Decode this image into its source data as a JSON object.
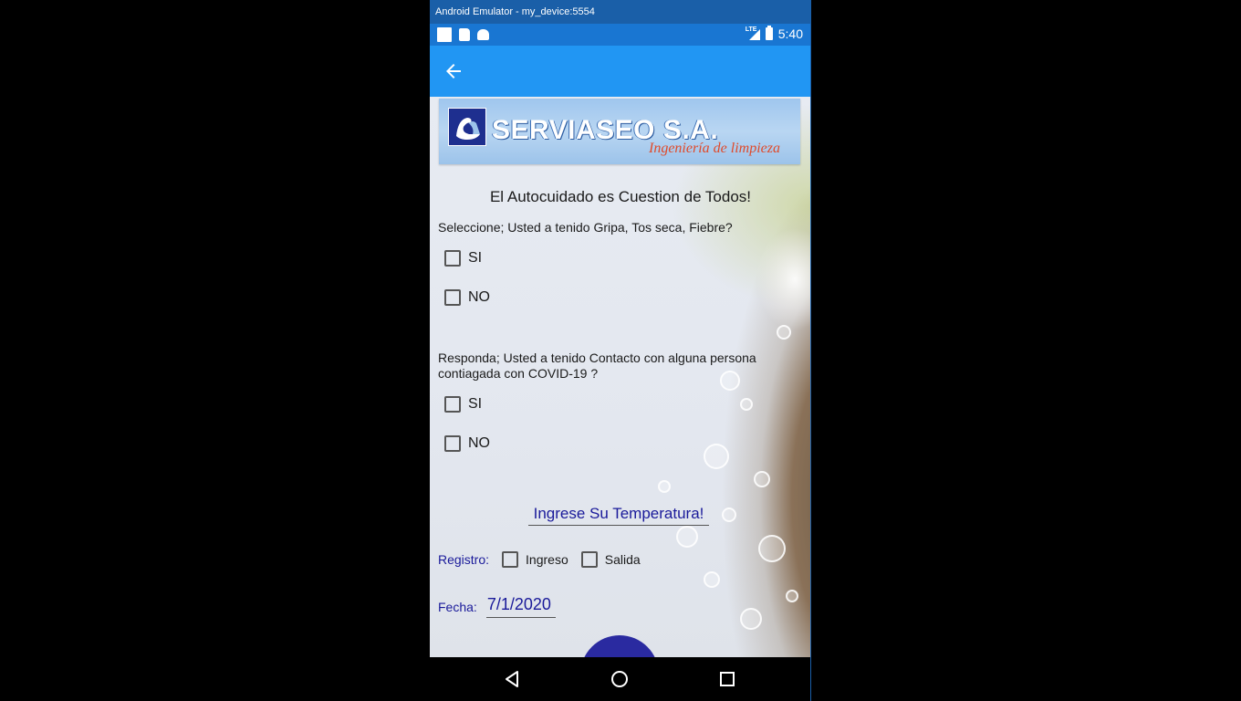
{
  "window": {
    "title": "Android Emulator - my_device:5554"
  },
  "status_bar": {
    "network": "LTE",
    "time": "5:40"
  },
  "app_bar": {
    "back_icon": "arrow-back-icon"
  },
  "logo": {
    "company": "SERVIASEO S.A.",
    "tagline": "Ingeniería de limpieza"
  },
  "form": {
    "headline": "El Autocuidado es Cuestion de Todos!",
    "q1": {
      "text": "Seleccione; Usted a tenido Gripa, Tos seca, Fiebre?",
      "options": [
        "SI",
        "NO"
      ]
    },
    "q2": {
      "text": "Responda; Usted a tenido Contacto con alguna persona contiagada con COVID-19 ?",
      "options": [
        "SI",
        "NO"
      ]
    },
    "temperature_prompt": "Ingrese Su Temperatura!",
    "registro": {
      "label": "Registro:",
      "options": [
        "Ingreso",
        "Salida"
      ]
    },
    "fecha": {
      "label": "Fecha:",
      "value": "7/1/2020"
    }
  },
  "nav_bar": {
    "icons": [
      "nav-back-icon",
      "nav-home-icon",
      "nav-recents-icon"
    ]
  },
  "colors": {
    "status_bar": "#1976d2",
    "app_bar": "#2196f3",
    "title_bar": "#1a5fa8",
    "accent_text": "#1a1a9a",
    "fab": "#2a2aa0"
  }
}
